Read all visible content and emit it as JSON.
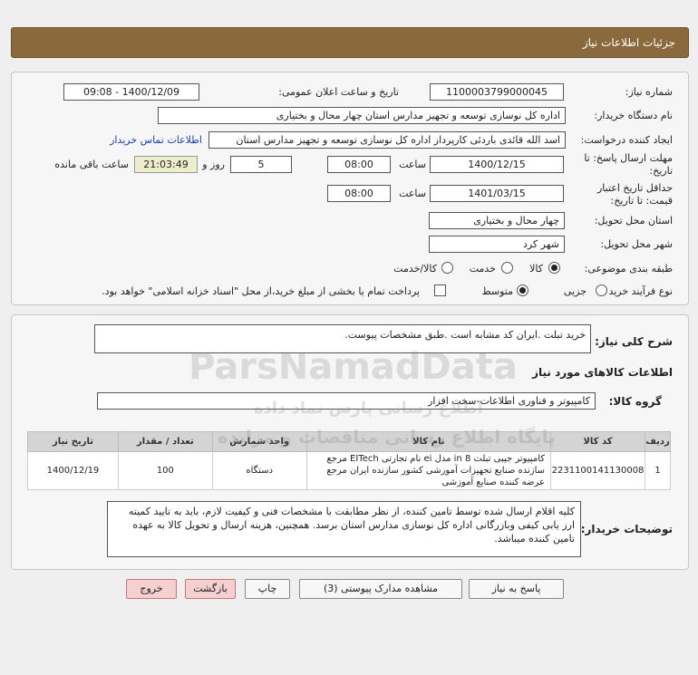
{
  "header": {
    "title": "جزئیات اطلاعات نیاز"
  },
  "form": {
    "need_number_label": "شماره نیاز:",
    "need_number": "1100003799000045",
    "announce_label": "تاریخ و ساعت اعلان عمومی:",
    "announce_value": "1400/12/09 - 09:08",
    "buyer_org_label": "نام دستگاه خریدار:",
    "buyer_org": "اداره کل نوسازی  توسعه و تجهیز مدارس استان چهار محال و بختیاری",
    "creator_label": "ایجاد کننده درخواست:",
    "creator": "اسد الله قائدی باردئی کارپرداز اداره کل نوسازی  توسعه و تجهیز مدارس استان",
    "contact_link": "اطلاعات تماس خریدار",
    "deadline_label_1": "مهلت ارسال پاسخ: تا",
    "deadline_label_2": "تاریخ:",
    "deadline_date": "1400/12/15",
    "time_label": "ساعت",
    "deadline_time": "08:00",
    "days_value": "5",
    "days_label": "روز و",
    "remaining_time": "21:03:49",
    "remaining_label": "ساعت باقی مانده",
    "validity_label_1": "حداقل تاریخ اعتبار",
    "validity_label_2": "قیمت: تا تاریخ:",
    "validity_date": "1401/03/15",
    "validity_time": "08:00",
    "province_label": "استان محل تحویل:",
    "province": "چهار محال و بختیاری",
    "city_label": "شهر محل تحویل:",
    "city": "شهر کرد",
    "category_label": "طبقه بندی موضوعی:",
    "category_options": [
      "کالا",
      "خدمت",
      "کالا/خدمت"
    ],
    "purchase_type_label": "نوع فرآیند خرید :",
    "purchase_options": [
      "جزیی",
      "متوسط"
    ],
    "payment_note": "پرداخت تمام یا بخشی از مبلغ خرید،از محل \"اسناد خزانه اسلامی\" خواهد بود."
  },
  "details": {
    "general_desc_label": "شرح کلی نیاز:",
    "general_desc": "خرید تبلت .ایران کد مشابه است .طبق مشخصات پیوست.",
    "goods_info_title": "اطلاعات کالاهای مورد نیاز",
    "goods_group_label": "گروه کالا:",
    "goods_group": "کامپیوتر و فناوری اطلاعات-سخت افزار",
    "table": {
      "headers": [
        "ردیف",
        "کد کالا",
        "نام کالا",
        "واحد شمارش",
        "تعداد / مقدار",
        "تاریخ نیاز"
      ],
      "rows": [
        {
          "row": "1",
          "code": "2231100141130008",
          "name": "کامپیوتر جیبی تبلت 8 in مدل ei نام تجارتی EITech مرجع سازنده صنایع تجهیزات آموزشی کشور سازنده ایران مرجع عرضه کننده صنایع آموزشی",
          "unit": "دستگاه",
          "qty": "100",
          "date": "1400/12/19"
        }
      ]
    },
    "buyer_notes_label": "توضیحات خریدار:",
    "buyer_notes": "کلیه اقلام ارسال شده توسط تامین کننده، از نظر مطابقت با مشخصات فنی و کیفیت لازم، باید به تایید کمیته ارز یابی کیفی وبازرگانی  اداره کل نوسازی مدارس استان برسد. همچنین، هزینه ارسال و تحویل کالا به عهده تامین کننده میباشد."
  },
  "buttons": {
    "reply": "پاسخ به نیاز",
    "docs": "مشاهده مدارک پیوستی (3)",
    "print": "چاپ",
    "back": "بازگشت",
    "exit": "خروج"
  },
  "watermark": {
    "main": "ParsNamadData",
    "line1": "اطلاع رسانی پارس نماد داده",
    "line2": "پایگاه اطلاع رسانی مناقصات و مزایده"
  },
  "colors": {
    "header": "#8a6a3d",
    "accent_link": "#1a3fb0",
    "exit_button": "#f6d0d0",
    "timer_bg": "#eeeecc"
  }
}
